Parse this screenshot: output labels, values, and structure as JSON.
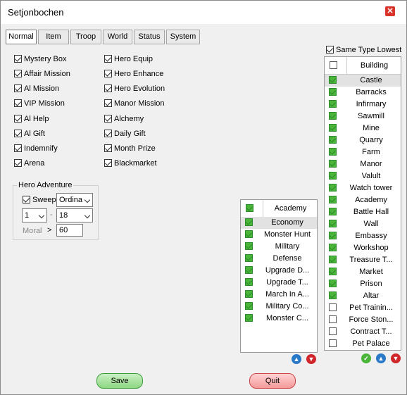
{
  "window": {
    "title": "Setjonbochen"
  },
  "tabs": [
    "Normal",
    "Item",
    "Troop",
    "World",
    "Status",
    "System"
  ],
  "options_left": [
    {
      "label": "Mystery Box",
      "checked": true
    },
    {
      "label": "Affair Mission",
      "checked": true
    },
    {
      "label": "Al Mission",
      "checked": true
    },
    {
      "label": "VIP Mission",
      "checked": true
    },
    {
      "label": "Al Help",
      "checked": true
    },
    {
      "label": "Al Gift",
      "checked": true
    },
    {
      "label": "Indemnify",
      "checked": true
    },
    {
      "label": "Arena",
      "checked": true
    }
  ],
  "options_right": [
    {
      "label": "Hero Equip",
      "checked": true
    },
    {
      "label": "Hero Enhance",
      "checked": true
    },
    {
      "label": "Hero Evolution",
      "checked": true
    },
    {
      "label": "Manor Mission",
      "checked": true
    },
    {
      "label": "Alchemy",
      "checked": true
    },
    {
      "label": "Daily Gift",
      "checked": true
    },
    {
      "label": "Month Prize",
      "checked": true
    },
    {
      "label": "Blackmarket",
      "checked": true
    }
  ],
  "hero_adventure": {
    "title": "Hero Adventure",
    "sweep_label": "Sweep",
    "sweep_checked": true,
    "mode": "Ordina",
    "range_from": "1",
    "range_sep": "-",
    "range_to": "18",
    "morale_label": "Moral",
    "morale_op": ">",
    "morale_value": "60"
  },
  "academy": {
    "header": "Academy",
    "items": [
      {
        "label": "Economy",
        "checked": true
      },
      {
        "label": "Monster Hunt",
        "checked": true
      },
      {
        "label": "Military",
        "checked": true
      },
      {
        "label": "Defense",
        "checked": true
      },
      {
        "label": "Upgrade D...",
        "checked": true
      },
      {
        "label": "Upgrade T...",
        "checked": true
      },
      {
        "label": "March In A...",
        "checked": true
      },
      {
        "label": "Military Co...",
        "checked": true
      },
      {
        "label": "Monster C...",
        "checked": true
      }
    ]
  },
  "same_type_lowest": {
    "label": "Same Type Lowest",
    "checked": true
  },
  "building": {
    "header": "Building",
    "items": [
      {
        "label": "Castle",
        "checked": true
      },
      {
        "label": "Barracks",
        "checked": true
      },
      {
        "label": "Infirmary",
        "checked": true
      },
      {
        "label": "Sawmill",
        "checked": true
      },
      {
        "label": "Mine",
        "checked": true
      },
      {
        "label": "Quarry",
        "checked": true
      },
      {
        "label": "Farm",
        "checked": true
      },
      {
        "label": "Manor",
        "checked": true
      },
      {
        "label": "Valult",
        "checked": true
      },
      {
        "label": "Watch tower",
        "checked": true
      },
      {
        "label": "Academy",
        "checked": true
      },
      {
        "label": "Battle Hall",
        "checked": true
      },
      {
        "label": "Wall",
        "checked": true
      },
      {
        "label": "Embassy",
        "checked": true
      },
      {
        "label": "Workshop",
        "checked": true
      },
      {
        "label": "Treasure T...",
        "checked": true
      },
      {
        "label": "Market",
        "checked": true
      },
      {
        "label": "Prison",
        "checked": true
      },
      {
        "label": "Altar",
        "checked": true
      },
      {
        "label": "Pet Trainin...",
        "checked": false
      },
      {
        "label": "Force Ston...",
        "checked": false
      },
      {
        "label": "Contract T...",
        "checked": false
      },
      {
        "label": "Pet Palace",
        "checked": false
      }
    ]
  },
  "buttons": {
    "save": "Save",
    "quit": "Quit"
  },
  "icons": {
    "up": "arrow-up-icon",
    "down": "arrow-down-icon",
    "ok": "check-icon",
    "close": "close-icon"
  }
}
